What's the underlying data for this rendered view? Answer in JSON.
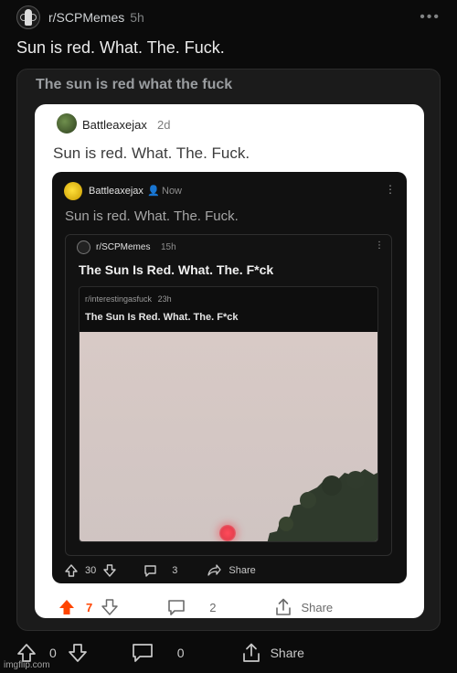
{
  "post": {
    "subreddit": "r/SCPMemes",
    "time": "5h",
    "title": "Sun is red. What. The. Fuck.",
    "upvotes": "0",
    "comments": "0",
    "share_label": "Share"
  },
  "frame": {
    "caption": "The sun is red what the fuck",
    "white_card": {
      "username": "Battleaxejax",
      "time": "2d",
      "title": "Sun is red. What. The. Fuck.",
      "upvotes": "7",
      "comments": "2",
      "share_label": "Share",
      "accent_color": "#ff4500"
    },
    "black_card": {
      "username": "Battleaxejax",
      "time": "Now",
      "title": "Sun is red. What. The. Fuck.",
      "inner_card": {
        "subreddit": "r/SCPMemes",
        "time": "15h",
        "title": "The Sun Is Red. What. The. F*ck",
        "upvotes": "30",
        "comments": "3",
        "share_label": "Share",
        "crosspost": {
          "subreddit": "r/interestingasfuck",
          "time": "23h",
          "title": "The Sun Is Red. What. The. F*ck"
        }
      }
    }
  },
  "watermark": "imgflip.com"
}
